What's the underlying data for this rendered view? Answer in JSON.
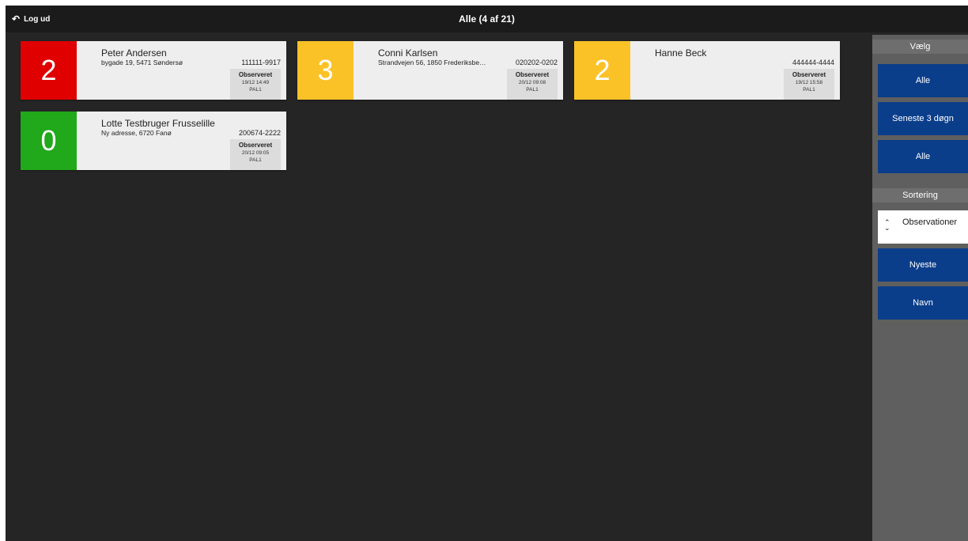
{
  "header": {
    "logout_label": "Log ud",
    "title": "Alle (4 af 21)"
  },
  "cards": [
    {
      "score": "2",
      "color": "#e00000",
      "name": "Peter Andersen",
      "address": "bygade 19, 5471 Søndersø",
      "id": "111111-9917",
      "status": "Observeret",
      "date": "19/12 14:49",
      "code": "PAL1"
    },
    {
      "score": "3",
      "color": "#fbc228",
      "name": "Conni Karlsen",
      "address": "Strandvejen 56, 1850 Frederiksbe…",
      "id": "020202-0202",
      "status": "Observeret",
      "date": "20/12 09:08",
      "code": "PAL1"
    },
    {
      "score": "2",
      "color": "#fbc228",
      "name": "Hanne Beck",
      "address": "",
      "id": "444444-4444",
      "status": "Observeret",
      "date": "19/12 15:58",
      "code": "PAL1"
    },
    {
      "score": "0",
      "color": "#22a81b",
      "name": "Lotte Testbruger Frusselille",
      "address": "Ny adresse, 6720 Fanø",
      "id": "200674-2222",
      "status": "Observeret",
      "date": "20/12 09:05",
      "code": "PAL1"
    }
  ],
  "sidebar": {
    "select_header": "Vælg",
    "select_buttons": [
      "Alle",
      "Seneste 3 døgn",
      "Alle"
    ],
    "sort_header": "Sortering",
    "sort_buttons": [
      "Observationer",
      "Nyeste",
      "Navn"
    ]
  }
}
